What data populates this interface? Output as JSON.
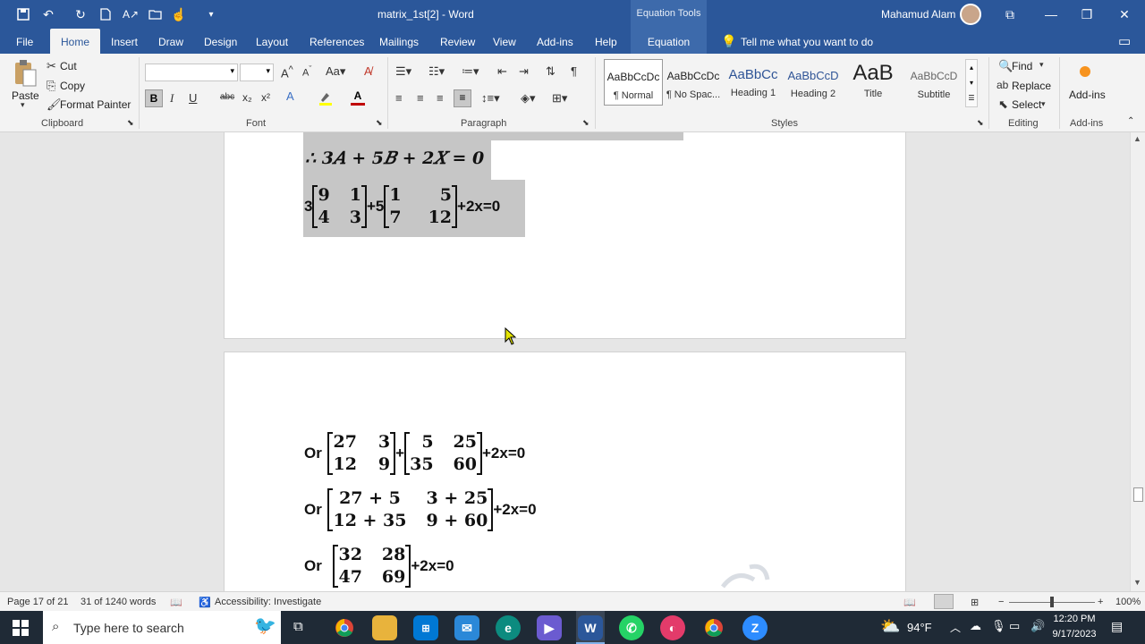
{
  "titlebar": {
    "doc_title": "matrix_1st[2]  -  Word",
    "tools_title": "Equation Tools",
    "user_name": "Mahamud Alam"
  },
  "tabs": [
    {
      "label": "File"
    },
    {
      "label": "Home"
    },
    {
      "label": "Insert"
    },
    {
      "label": "Draw"
    },
    {
      "label": "Design"
    },
    {
      "label": "Layout"
    },
    {
      "label": "References"
    },
    {
      "label": "Mailings"
    },
    {
      "label": "Review"
    },
    {
      "label": "View"
    },
    {
      "label": "Add-ins"
    },
    {
      "label": "Help"
    },
    {
      "label": "Equation"
    }
  ],
  "tell_me": "Tell me what you want to do",
  "clipboard": {
    "paste": "Paste",
    "cut": "Cut",
    "copy": "Copy",
    "format_painter": "Format Painter",
    "label": "Clipboard"
  },
  "font": {
    "label": "Font",
    "bold": "B",
    "italic": "I",
    "underline": "U",
    "strike": "abc",
    "sub": "x₂",
    "sup": "x²"
  },
  "paragraph": {
    "label": "Paragraph"
  },
  "styles": {
    "label": "Styles",
    "items": [
      {
        "sample": "AaBbCcDc",
        "name": "¶ Normal"
      },
      {
        "sample": "AaBbCcDc",
        "name": "¶ No Spac..."
      },
      {
        "sample": "AaBbCc",
        "name": "Heading 1"
      },
      {
        "sample": "AaBbCcD",
        "name": "Heading 2"
      },
      {
        "sample": "AaB",
        "name": "Title"
      },
      {
        "sample": "AaBbCcD",
        "name": "Subtitle"
      }
    ]
  },
  "editing": {
    "find": "Find",
    "replace": "Replace",
    "select": "Select",
    "label": "Editing"
  },
  "addins": {
    "button": "Add-ins",
    "label": "Add-ins"
  },
  "document": {
    "eq1": "∴ 3𝐴 + 5𝐵 + 2𝑋 = 0",
    "eq2": {
      "coef1": "3",
      "m1": [
        "9",
        "1",
        "4",
        "3"
      ],
      "op": "+5",
      "m2": [
        "1",
        "5",
        "7",
        "12"
      ],
      "tail": "+2x=0"
    },
    "eq3": {
      "prefix": "Or",
      "m1": [
        "27",
        "3",
        "12",
        "9"
      ],
      "op": "+",
      "m2": [
        "5",
        "25",
        "35",
        "60"
      ],
      "tail": "+2x=0"
    },
    "eq4": {
      "prefix": "Or",
      "m1": [
        "27 + 5",
        "3 + 25",
        "12 + 35",
        "9 + 60"
      ],
      "tail": "+2x=0"
    },
    "eq5": {
      "prefix": "Or",
      "m1": [
        "32",
        "28",
        "47",
        "69"
      ],
      "tail": "+2x=0"
    }
  },
  "status": {
    "page": "Page 17 of 21",
    "words": "31 of 1240 words",
    "accessibility": "Accessibility: Investigate",
    "zoom": "100%"
  },
  "taskbar": {
    "search_placeholder": "Type here to search",
    "weather": "94°F",
    "time": "12:20 PM",
    "date": "9/17/2023"
  }
}
